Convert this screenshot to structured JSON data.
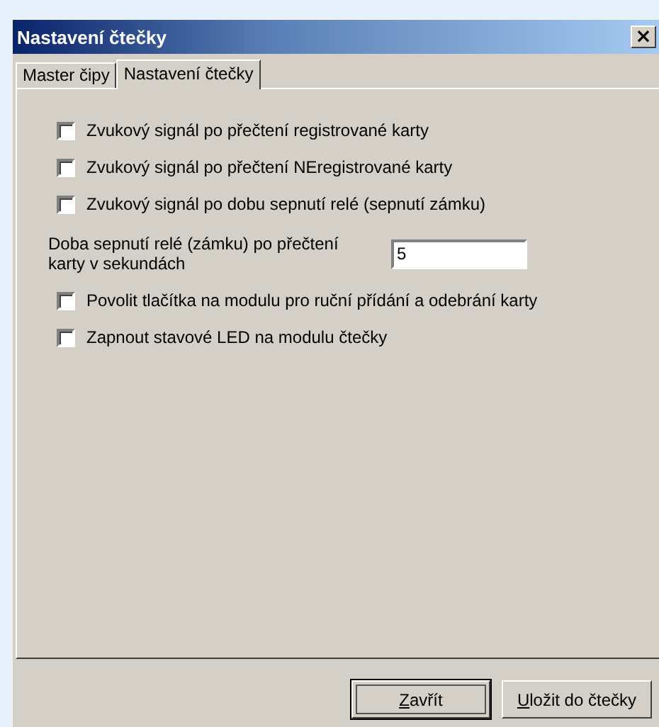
{
  "window": {
    "title": "Nastavení čtečky",
    "close": "×"
  },
  "tabs": [
    {
      "label": "Master čipy",
      "selected": false
    },
    {
      "label": "Nastavení čtečky",
      "selected": true
    }
  ],
  "options": [
    {
      "kind": "checkbox",
      "label": "Zvukový signál po přečtení registrované karty",
      "checked": false
    },
    {
      "kind": "checkbox",
      "label": "Zvukový signál po přečtení NEregistrované karty",
      "checked": false
    },
    {
      "kind": "checkbox",
      "label": "Zvukový signál po dobu sepnutí relé (sepnutí zámku)",
      "checked": false
    },
    {
      "kind": "field",
      "label": "Doba sepnutí relé (zámku) po přečtení karty v sekundách",
      "value": "5"
    },
    {
      "kind": "checkbox",
      "label": "Povolit tlačítka na modulu pro ruční přídání a odebrání karty",
      "checked": false
    },
    {
      "kind": "checkbox",
      "label": "Zapnout stavové LED na modulu čtečky",
      "checked": false
    }
  ],
  "buttons": [
    {
      "label": "Zavřít",
      "default": true
    },
    {
      "label": "Uložit do čtečky",
      "default": false
    }
  ]
}
